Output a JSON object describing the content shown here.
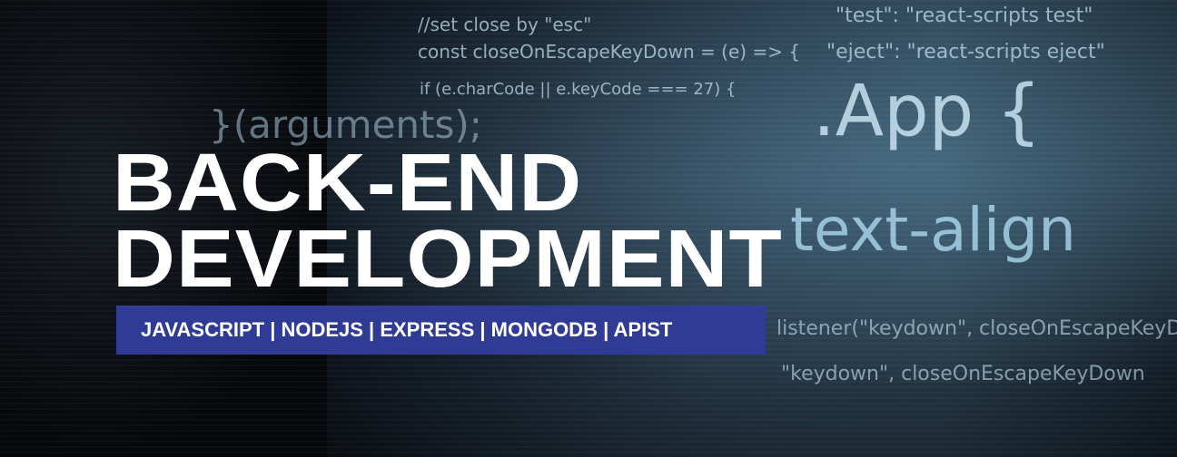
{
  "background_code": [
    "//set close by \"esc\"",
    "const closeOnEscapeKeyDown = (e) => {",
    "if (e.charCode || e.keyCode === 27) {",
    ".App {",
    "text-align",
    "}(arguments);",
    "\"test\": \"react-scripts test\"",
    "\"eject\": \"react-scripts eject\"",
    "\"keydown\", closeOnEscapeKeyDown",
    "listener(\"keydown\", closeOnEscapeKeyDown"
  ],
  "banner": {
    "title_line1": "BACK-END",
    "title_line2": "DEVELOPMENT",
    "tags": "JAVASCRIPT | NODEJS | EXPRESS | MONGODB | APIST",
    "tag_bar_color": "#2f3b95"
  }
}
